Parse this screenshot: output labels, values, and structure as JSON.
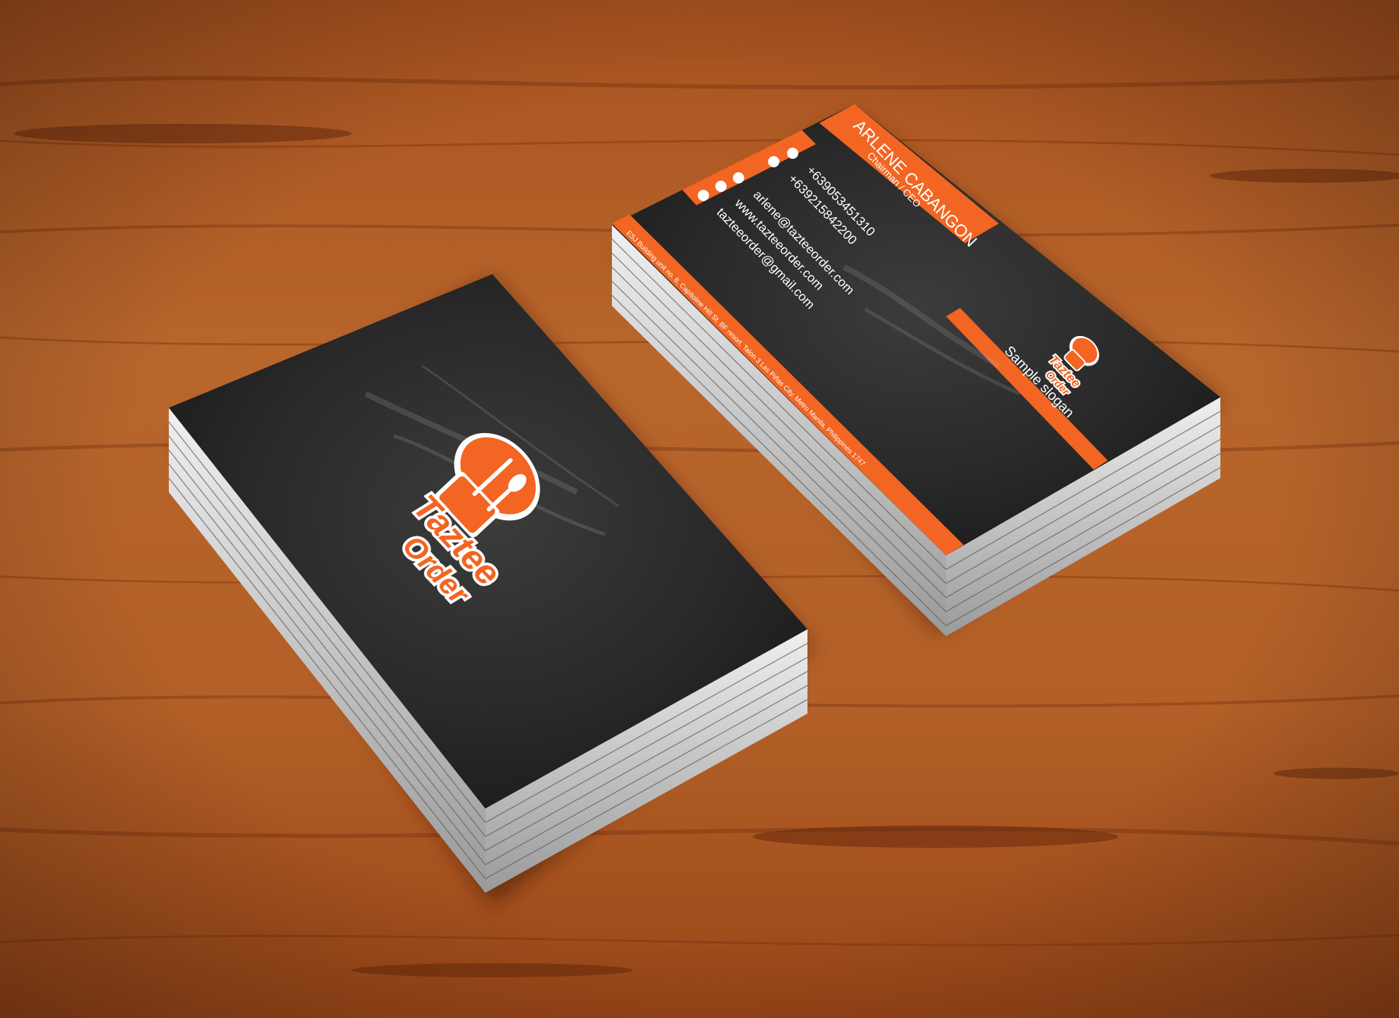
{
  "colors": {
    "accent": "#f26522",
    "card": "#2b2b2b",
    "card_dark": "#1c1c1c",
    "wood": "#b5612a",
    "wood_dark": "#7a3512",
    "paper_edge": "#e4e4e4"
  },
  "back_card": {
    "logo_word_1": "Taztee",
    "logo_word_2": "Order",
    "logo_icon": "chef-hat-icon"
  },
  "front_card": {
    "name": "ARLENE CABANGON",
    "title": "Chairman / CEO",
    "phone_1": "+639053451310",
    "phone_2": "+639215842200",
    "email_1": "arlene@tazteeorder.com",
    "website": "www.tazteeorder.com",
    "email_2": "tazteeorder@gmail.com",
    "slogan": "Sample slogan",
    "address": "ESJ Building unit no. 8, Capitoline Hill St. BF resort, Talon 3 Las Piñas City, Metro Manila, Philippines 1747",
    "logo_word_1": "Taztee",
    "logo_word_2": "Order",
    "contact_icons": [
      "phone-icon",
      "mobile-icon",
      "email-icon",
      "globe-icon",
      "mail-icon"
    ]
  }
}
